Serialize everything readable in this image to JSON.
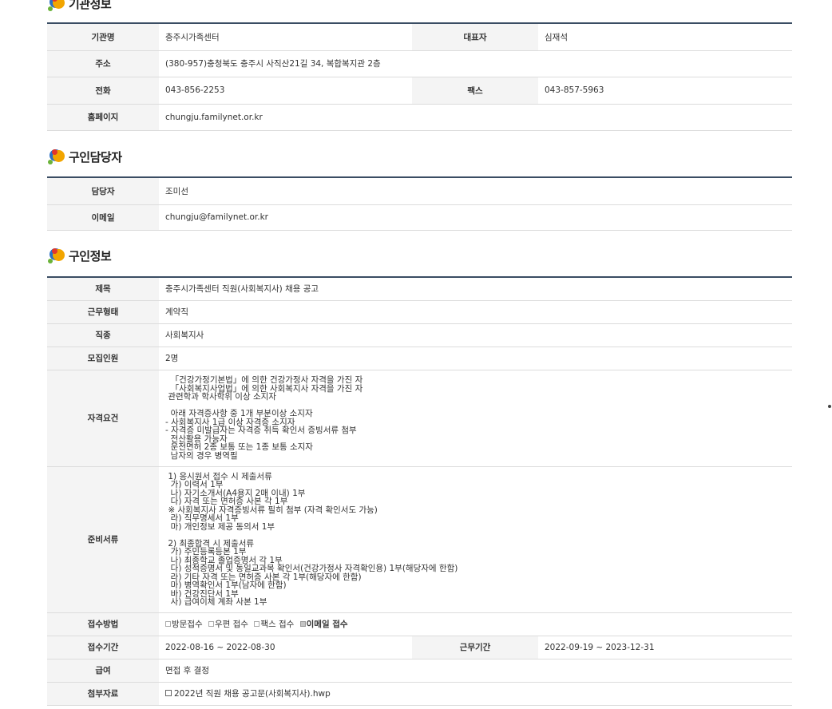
{
  "org": {
    "title": "기관정보",
    "rows": {
      "name_label": "기관명",
      "name": "충주시가족센터",
      "rep_label": "대표자",
      "rep": "심재석",
      "addr_label": "주소",
      "addr": "(380-957)충청북도 충주시 사직산21길 34, 복합복지관 2층",
      "tel_label": "전화",
      "tel": "043-856-2253",
      "fax_label": "팩스",
      "fax": "043-857-5963",
      "home_label": "홈페이지",
      "home": "chungju.familynet.or.kr"
    }
  },
  "contact": {
    "title": "구인담당자",
    "manager_label": "담당자",
    "manager": "조미선",
    "email_label": "이메일",
    "email": "chungju@familynet.or.kr"
  },
  "job": {
    "title": "구인정보",
    "subject_label": "제목",
    "subject": "충주시가족센터 직원(사회복지사) 채용 공고",
    "type_label": "근무형태",
    "type": "계약직",
    "occupation_label": "직종",
    "occupation": "사회복지사",
    "headcount_label": "모집인원",
    "headcount": "2명",
    "qual_label": "자격요건",
    "qual": "  「건강가정기본법」에 의한 건강가정사 자격을 가진 자\n  「사회복지사업법」에 의한 사회복지사 자격을 가진 자\n 관련학과 학사학위 이상 소지자\n\n  아래 자격증사항 중 1개 부분이상 소지자\n- 사회복지사 1급 이상 자격증 소지자\n- 자격증 미발급자는 자격증 취득 확인서 증빙서류 첨부\n  전산활용 가능자\n  운전면허 2종 보통 또는 1종 보통 소지자\n  남자의 경우 병역필",
    "docs_label": "준비서류",
    "docs": " 1) 응시원서 접수 시 제출서류\n  가) 이력서 1부\n  나) 자기소개서(A4용지 2매 이내) 1부\n  다) 자격 또는 면허증 사본 각 1부\n ※ 사회복지사 자격증빙서류 필히 첨부 (자격 확인서도 가능)\n  라) 직무명세서 1부\n  마) 개인정보 제공 동의서 1부\n\n 2) 최종합격 시 제출서류\n  가) 주민등록등본 1부\n  나) 최종학교 졸업증명서 각 1부\n  다) 성적증명서 및 동일교과목 확인서(건강가정사 자격확인용) 1부(해당자에 한함)\n  라) 기타 자격 또는 면허증 사본 각 1부(해당자에 한함)\n  마) 병역확인서 1부(남자에 한함)\n  바) 건강진단서 1부\n  사) 급여이체 계좌 사본 1부",
    "method_label": "접수방법",
    "methods": [
      "방문접수",
      "우편 접수",
      "팩스 접수",
      "이메일 접수"
    ],
    "period_label": "접수기간",
    "period": "2022-08-16 ~ 2022-08-30",
    "work_period_label": "근무기간",
    "work_period": "2022-09-19 ~ 2023-12-31",
    "salary_label": "급여",
    "salary": "면접 후 결정",
    "attach_label": "첨부자료",
    "attach": "2022년 직원 채용 공고문(사회복지사).hwp"
  }
}
